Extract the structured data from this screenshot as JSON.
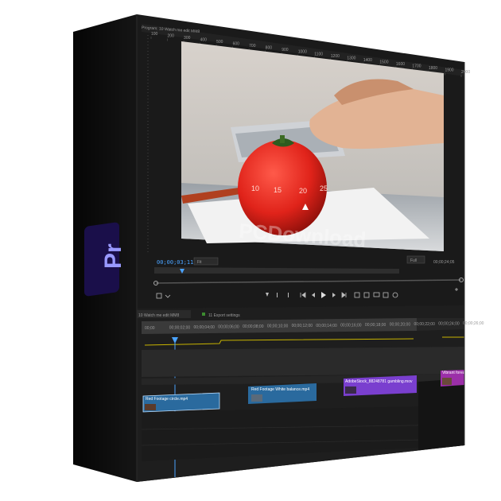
{
  "colors": {
    "box_side": "#0c0c0c",
    "panel_bg": "#1a1a1a",
    "timeline_bg": "#222222",
    "accent_blue": "#2d8cff",
    "logo_bg": "#1a0f4a",
    "logo_text": "#9999ff",
    "clip_blue": "#2a6a9e",
    "clip_purple": "#7a3fcf",
    "clip_magenta": "#9b2fa8",
    "playhead": "#4aa3ff"
  },
  "logo": {
    "text": "Pr"
  },
  "program_monitor": {
    "title": "Program: 10 Watch me edit MM8",
    "ruler_labels": [
      "100",
      "200",
      "300",
      "400",
      "500",
      "600",
      "700",
      "800",
      "900",
      "1000",
      "1100",
      "1200",
      "1300",
      "1400",
      "1500",
      "1600",
      "1700",
      "1800",
      "1900",
      "2000"
    ],
    "current_timecode": "00;00;03;11",
    "fit_label": "Fit",
    "full_label": "Full",
    "duration_timecode": "00;00;24;05",
    "watermark": "PCDownload",
    "timer_numbers": [
      "10",
      "15",
      "20",
      "25"
    ]
  },
  "timeline": {
    "tabs": [
      {
        "label": "10 Watch me edit MM8",
        "active": true
      },
      {
        "label": "11 Export settings",
        "active": false
      }
    ],
    "ruler_times": [
      "00;00",
      "00;00;02;00",
      "00;00;04;00",
      "00;00;06;00",
      "00;00;08;00",
      "00;00;10;00",
      "00;00;12;00",
      "00;00;14;00",
      "00;00;16;00",
      "00;00;18;00",
      "00;00;20;00",
      "00;00;22;00",
      "00;00;24;00",
      "00;00;26;00"
    ],
    "clips": [
      {
        "name": "Red Footage circle.mp4",
        "color": "#2a6a9e"
      },
      {
        "name": "Red Footage White balance.mp4",
        "color": "#2a6a9e"
      },
      {
        "name": "AdobeStock_88248781 gambling.mov",
        "color": "#7a3fcf"
      },
      {
        "name": "Vibrant foreal Mockup",
        "color": "#9b2fa8"
      }
    ]
  }
}
